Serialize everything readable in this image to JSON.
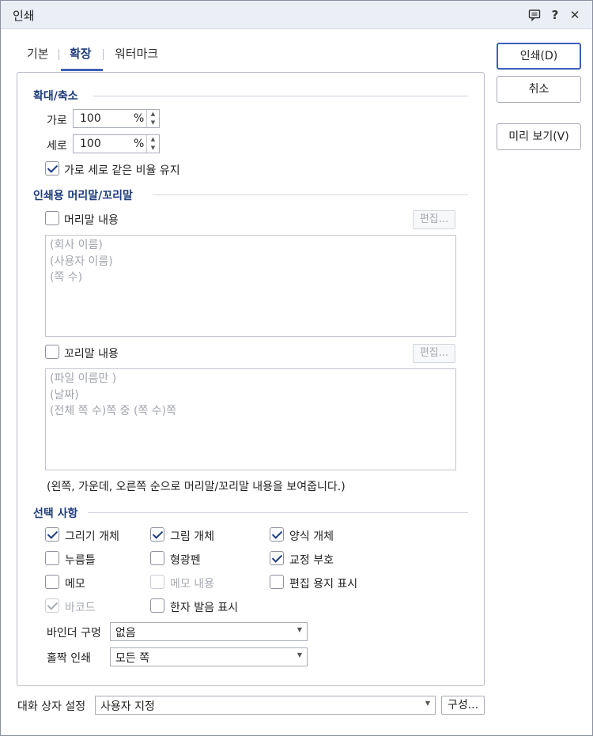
{
  "window": {
    "title": "인쇄"
  },
  "tabs": [
    {
      "label": "기본"
    },
    {
      "label": "확장"
    },
    {
      "label": "워터마크"
    }
  ],
  "zoom": {
    "title": "확대/축소",
    "width_label": "가로",
    "width_value": "100",
    "height_label": "세로",
    "height_value": "100",
    "unit": "%",
    "keep_ratio_label": "가로 세로 같은 비율 유지"
  },
  "header_footer": {
    "title": "인쇄용 머리말/꼬리말",
    "header_label": "머리말 내용",
    "header_edit": "편집...",
    "header_lines": [
      "(회사 이름)",
      "(사용자 이름)",
      "(쪽 수)"
    ],
    "footer_label": "꼬리말 내용",
    "footer_edit": "편집...",
    "footer_lines": [
      "(파일 이름만 )",
      "(날짜)",
      "(전체 쪽 수)쪽 중 (쪽 수)쪽"
    ],
    "note": "(왼쪽, 가운데, 오른쪽 순으로 머리말/꼬리말 내용을 보여줍니다.)"
  },
  "options": {
    "title": "선택 사항",
    "items": [
      {
        "label": "그리기 개체"
      },
      {
        "label": "그림 개체"
      },
      {
        "label": "양식 개체"
      },
      {
        "label": "누름틀"
      },
      {
        "label": "형광펜"
      },
      {
        "label": "교정 부호"
      },
      {
        "label": "메모"
      },
      {
        "label": "메모 내용"
      },
      {
        "label": "편집 용지 표시"
      },
      {
        "label": "바코드"
      },
      {
        "label": "한자 발음 표시"
      }
    ],
    "binder_label": "바인더 구멍",
    "binder_value": "없음",
    "oddeven_label": "홀짝 인쇄",
    "oddeven_value": "모든 쪽"
  },
  "footer_bar": {
    "label": "대화 상자 설정",
    "value": "사용자 지정",
    "config_button": "구성..."
  },
  "buttons": {
    "print": "인쇄(D)",
    "cancel": "취소",
    "preview": "미리 보기(V)"
  }
}
